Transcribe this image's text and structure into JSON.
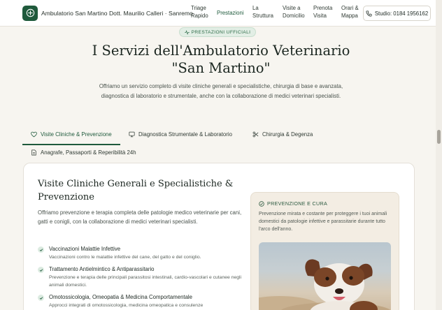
{
  "header": {
    "brand": "Ambulatorio San Martino Dott. Maurilio Calleri · Sanremo",
    "nav": [
      {
        "line1": "Triage",
        "line2": "Rapido"
      },
      {
        "line1": "Prestazioni",
        "line2": ""
      },
      {
        "line1": "La",
        "line2": "Struttura"
      },
      {
        "line1": "Visite a",
        "line2": "Domicilio"
      },
      {
        "line1": "Prenota",
        "line2": "Visita"
      },
      {
        "line1": "Orari &",
        "line2": "Mappa"
      }
    ],
    "active_nav": "Prestazioni",
    "phone_label": "Studio: 0184 1956162"
  },
  "hero": {
    "badge": "PRESTAZIONI UFFICIALI",
    "title_line1": "I Servizi dell'Ambulatorio Veterinario",
    "title_line2": "\"San Martino\"",
    "desc": "Offriamo un servizio completo di visite cliniche generali e specialistiche, chirurgia di base e avanzata, diagnostica di laboratorio e strumentale, anche con la collaborazione di medici veterinari specialisti."
  },
  "tabs": [
    {
      "label": "Visite Cliniche & Prevenzione",
      "icon": "heart-icon",
      "active": true
    },
    {
      "label": "Diagnostica Strumentale & Laboratorio",
      "icon": "monitor-icon",
      "active": false
    },
    {
      "label": "Chirurgia & Degenza",
      "icon": "scissors-icon",
      "active": false
    },
    {
      "label": "Anagrafe, Passaporti & Reperibilità 24h",
      "icon": "document-icon",
      "active": false
    }
  ],
  "card": {
    "title_line1": "Visite Cliniche Generali e Specialistiche &",
    "title_line2": "Prevenzione",
    "desc": "Offriamo prevenzione e terapia completa delle patologie medico veterinarie per cani, gatti e conigli, con la collaborazione di medici veterinari specialisti.",
    "features": [
      {
        "title": "Vaccinazioni Malattie Infettive",
        "desc": "Vaccinazioni contro le malattie infettive del cane, del gatto e del coniglio."
      },
      {
        "title": "Trattamento Antielmintico & Antiparassitario",
        "desc": "Prevenzione e terapia delle principali parassitosi intestinali, cardio-vascolari e cutanee negli animali domestici."
      },
      {
        "title": "Omotossicologia, Omeopatia & Medicina Comportamentale",
        "desc": "Approcci integrati di omotossicologia, medicina omeopatica e consulenze"
      }
    ]
  },
  "side": {
    "heading": "PREVENZIONE E CURA",
    "desc": "Prevenzione mirata e costante per proteggere i tuoi animali domestici da patologie infettive e parassitarie durante tutto l'arco dell'anno."
  },
  "colors": {
    "accent": "#1f5a3c",
    "background": "#f7f5f0",
    "side_box": "#f3ede3"
  }
}
